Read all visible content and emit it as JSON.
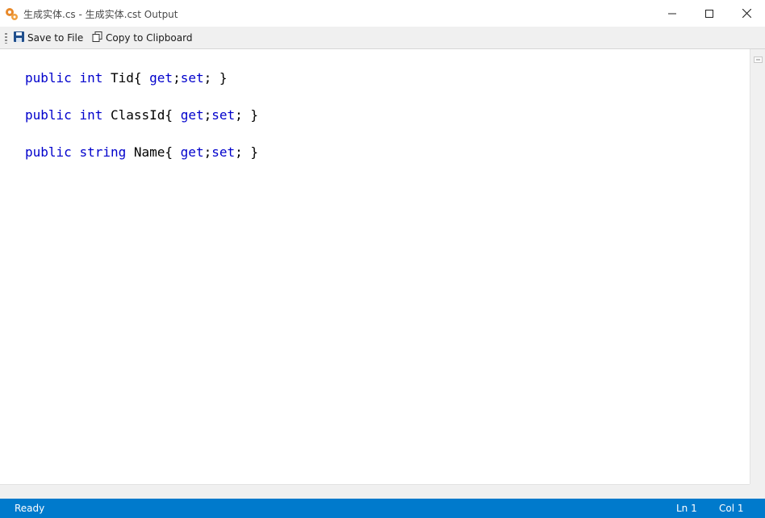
{
  "window": {
    "title": "生成实体.cs - 生成实体.cst Output",
    "icon": "gears-icon",
    "controls": [
      "minimize-icon",
      "maximize-icon",
      "close-icon"
    ]
  },
  "toolbar": {
    "save_label": "Save to File",
    "copy_label": "Copy to Clipboard"
  },
  "editor": {
    "keyword_color": "#0000cc",
    "lines": [
      {
        "kw1": "public",
        "kw2": "int",
        "name": "Tid{ ",
        "kw3": "get",
        "sep": ";",
        "kw4": "set",
        "end": "; }"
      },
      {
        "kw1": "public",
        "kw2": "int",
        "name": "ClassId{ ",
        "kw3": "get",
        "sep": ";",
        "kw4": "set",
        "end": "; }"
      },
      {
        "kw1": "public",
        "kw2": "string",
        "name": "Name{ ",
        "kw3": "get",
        "sep": ";",
        "kw4": "set",
        "end": "; }"
      }
    ]
  },
  "statusbar": {
    "status": "Ready",
    "ln": "Ln 1",
    "col": "Col 1",
    "color": "#007acc"
  }
}
